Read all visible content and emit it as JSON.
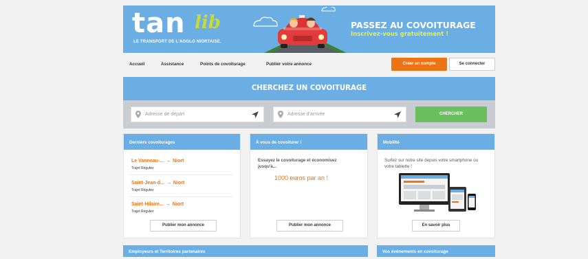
{
  "banner": {
    "logo_main": "tan",
    "logo_script": "lib",
    "logo_tagline": "LE TRANSPORT DE L'AGGLO NIORTAISE.",
    "headline": "PASSEZ AU COVOITURAGE",
    "subheadline": "Inscrivez-vous gratuitement !"
  },
  "nav": {
    "items": [
      {
        "label": "Accueil"
      },
      {
        "label": "Assistance"
      },
      {
        "label": "Points de covoiturage"
      },
      {
        "label": "Publier votre annonce"
      }
    ],
    "create_account": "Créer un compte",
    "login": "Se connecter"
  },
  "search": {
    "title": "CHERCHEZ UN COVOITURAGE",
    "departure_placeholder": "Adresse de départ",
    "arrival_placeholder": "Adresse d'arrivée",
    "button": "CHERCHER"
  },
  "recent": {
    "title": "Derniers covoiturages",
    "trips": [
      {
        "from": "Le Vanneau-...",
        "to": "Niort",
        "type": "Trajet Régulier"
      },
      {
        "from": "Saint-Jean-d...",
        "to": "Niort",
        "type": "Trajet Régulier"
      },
      {
        "from": "Saint-Hilaire...",
        "to": "Niort",
        "type": "Trajet Régulier"
      }
    ],
    "button": "Publier mon annonce"
  },
  "promo": {
    "title": "À vous de covoiturer !",
    "text": "Essayez le covoiturage et économisez jusqu'à...",
    "amount": "1000 euros par an !",
    "button": "Publier mon annonce"
  },
  "mobility": {
    "title": "Mobilité",
    "text": "Surfez sur notre site depuis votre smartphone ou votre tablette !",
    "button": "En savoir plus"
  },
  "bottom": {
    "left_title": "Employeurs et Territoires partenaires",
    "right_title": "Vos événements en covoiturage"
  },
  "colors": {
    "blue": "#6aaee3",
    "orange": "#ed7414",
    "green": "#6cbf5e",
    "lime": "#c8d93a"
  }
}
